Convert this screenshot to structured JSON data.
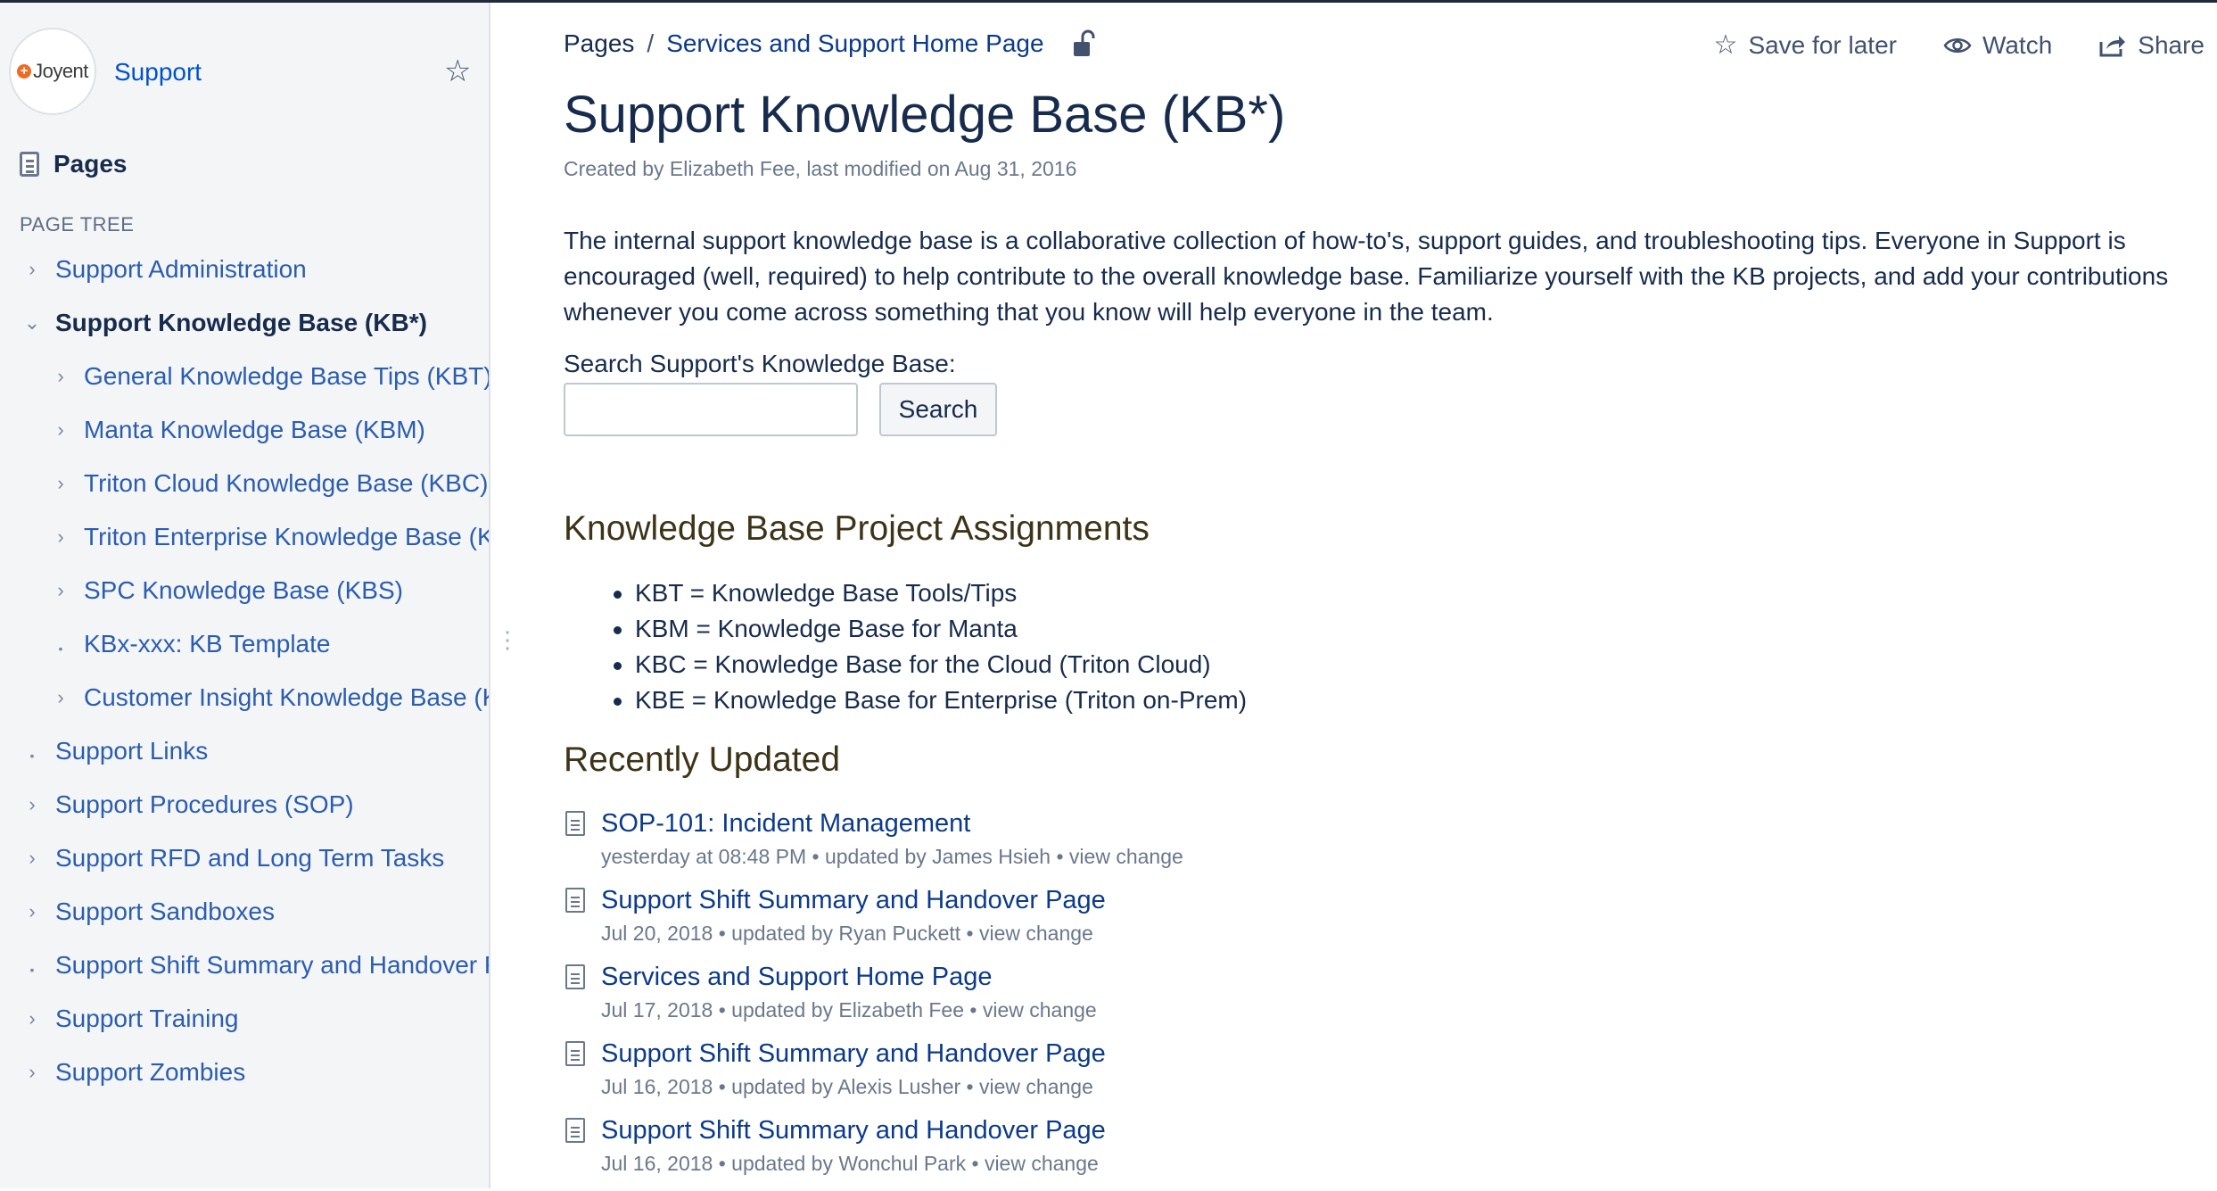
{
  "sidebar": {
    "space_logo_text": "Joyent",
    "space_name": "Support",
    "pages_label": "Pages",
    "page_tree_heading": "PAGE TREE",
    "tree": [
      {
        "label": "Support Administration",
        "level": 1,
        "toggle": "›"
      },
      {
        "label": "Support Knowledge Base (KB*)",
        "level": 1,
        "toggle": "⌄",
        "current": true
      },
      {
        "label": "General Knowledge Base Tips (KBT)",
        "level": 2,
        "toggle": "›"
      },
      {
        "label": "Manta Knowledge Base (KBM)",
        "level": 2,
        "toggle": "›"
      },
      {
        "label": "Triton Cloud Knowledge Base (KBC)",
        "level": 2,
        "toggle": "›"
      },
      {
        "label": "Triton Enterprise Knowledge Base (K",
        "level": 2,
        "toggle": "›"
      },
      {
        "label": "SPC Knowledge Base (KBS)",
        "level": 2,
        "toggle": "›"
      },
      {
        "label": "KBx-xxx: KB Template",
        "level": 2,
        "toggle": "•"
      },
      {
        "label": "Customer Insight Knowledge Base (K",
        "level": 2,
        "toggle": "›"
      },
      {
        "label": "Support Links",
        "level": 1,
        "toggle": "•"
      },
      {
        "label": "Support Procedures (SOP)",
        "level": 1,
        "toggle": "›"
      },
      {
        "label": "Support RFD and Long Term Tasks",
        "level": 1,
        "toggle": "›"
      },
      {
        "label": "Support Sandboxes",
        "level": 1,
        "toggle": "›"
      },
      {
        "label": "Support Shift Summary and Handover F",
        "level": 1,
        "toggle": "•"
      },
      {
        "label": "Support Training",
        "level": 1,
        "toggle": "›"
      },
      {
        "label": "Support Zombies",
        "level": 1,
        "toggle": "›"
      }
    ]
  },
  "breadcrumb": {
    "items": [
      "Pages",
      "Services and Support Home Page"
    ],
    "separator": "/"
  },
  "actions": {
    "save_for_later": "Save for later",
    "watch": "Watch",
    "share": "Share"
  },
  "page": {
    "title": "Support Knowledge Base (KB*)",
    "byline": "Created by Elizabeth Fee, last modified on Aug 31, 2016",
    "intro": "The internal support knowledge base is a collaborative collection of how-to's, support guides, and troubleshooting tips. Everyone in Support is encouraged (well, required) to help contribute to the overall knowledge base. Familiarize yourself with the KB projects, and add your contributions whenever you come across something that you know will help everyone in the team.",
    "search_label": "Search Support's Knowledge Base:",
    "search_value": "",
    "search_button": "Search",
    "assignments_heading": "Knowledge Base Project Assignments",
    "assignments": [
      "KBT = Knowledge Base Tools/Tips",
      "KBM = Knowledge Base for Manta",
      "KBC = Knowledge Base for the Cloud (Triton Cloud)",
      "KBE = Knowledge Base for Enterprise (Triton on-Prem)"
    ],
    "recent_heading": "Recently Updated",
    "recent": [
      {
        "title": "SOP-101: Incident Management",
        "meta": "yesterday at 08:48 PM • updated by James Hsieh • view change"
      },
      {
        "title": "Support Shift Summary and Handover Page",
        "meta": "Jul 20, 2018 • updated by Ryan Puckett • view change"
      },
      {
        "title": "Services and Support Home Page",
        "meta": "Jul 17, 2018 • updated by Elizabeth Fee • view change"
      },
      {
        "title": "Support Shift Summary and Handover Page",
        "meta": "Jul 16, 2018 • updated by Alexis Lusher • view change"
      },
      {
        "title": "Support Shift Summary and Handover Page",
        "meta": "Jul 16, 2018 • updated by Wonchul Park • view change"
      }
    ]
  },
  "colors": {
    "link": "#2a5db0",
    "dark_link": "#0b3a8c",
    "sidebar_bg": "#f4f5f7",
    "brand_orange": "#f26a21"
  },
  "icons": {
    "space_star": "star-outline-icon",
    "pages": "pages-icon",
    "lock": "unlocked-icon",
    "save": "star-outline-icon",
    "watch": "eye-icon",
    "share": "share-icon",
    "doc": "document-icon"
  }
}
